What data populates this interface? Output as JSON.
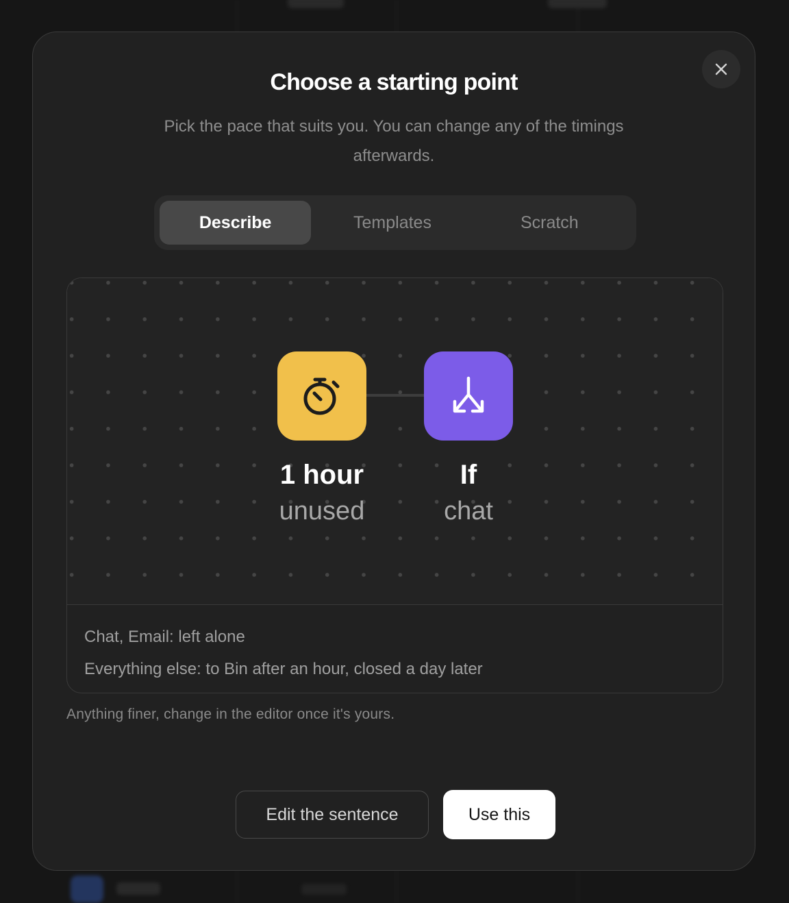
{
  "modal": {
    "title": "Choose a starting point",
    "subtitle": "Pick the pace that suits you. You can change any of the timings afterwards.",
    "close_icon": "close-icon"
  },
  "tabs": [
    {
      "label": "Describe",
      "active": true
    },
    {
      "label": "Templates",
      "active": false
    },
    {
      "label": "Scratch",
      "active": false
    }
  ],
  "preview": {
    "nodes": [
      {
        "icon": "stopwatch-icon",
        "color": "#f1c04b",
        "title": "1 hour",
        "subtitle": "unused"
      },
      {
        "icon": "branch-split-icon",
        "color": "#7c5ce8",
        "title": "If",
        "subtitle": "chat"
      }
    ],
    "summary": [
      "Chat, Email: left alone",
      "Everything else: to Bin after an hour, closed a day later"
    ]
  },
  "footnote": "Anything finer, change in the editor once it's yours.",
  "actions": {
    "edit_label": "Edit the sentence",
    "use_label": "Use this"
  },
  "colors": {
    "modal_bg": "#212121",
    "accent_timer": "#f1c04b",
    "accent_condition": "#7c5ce8",
    "primary_button": "#ffffff"
  }
}
